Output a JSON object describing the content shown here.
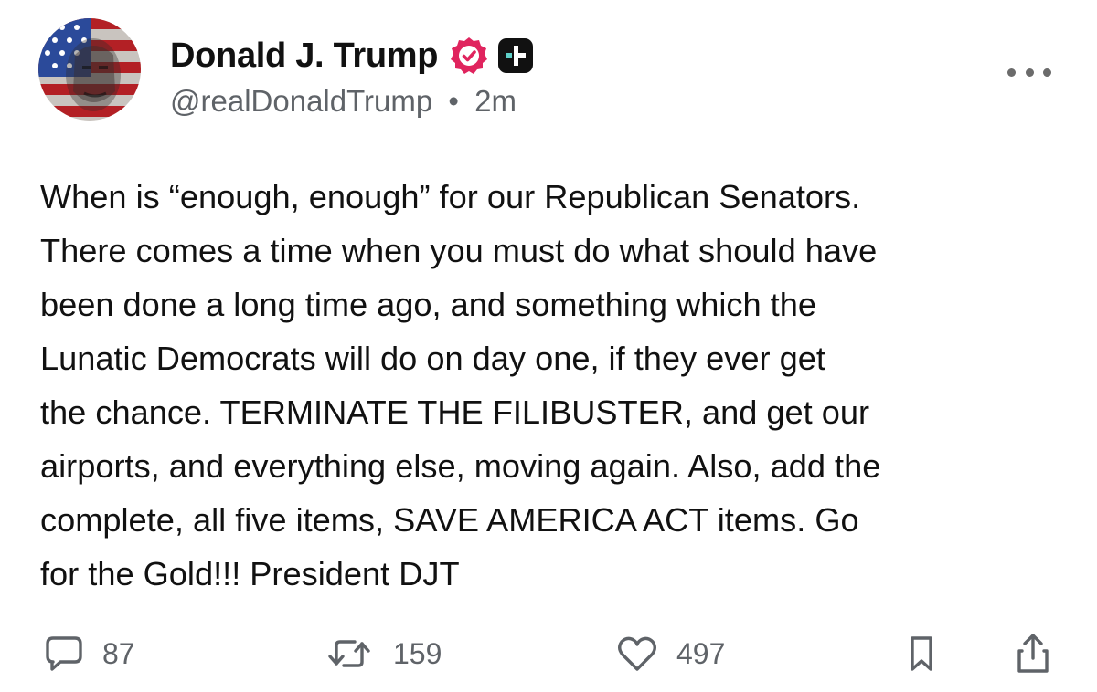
{
  "post": {
    "author": {
      "display_name": "Donald J. Trump",
      "handle": "@realDonaldTrump",
      "time": "2m",
      "separator": "•",
      "verified_badge": "verified-badge-icon",
      "badge_color": "#e0245e",
      "plus_badge": "plus-badge-icon",
      "avatar": "avatar-image"
    },
    "text": "When is “enough, enough” for our Republican Senators.\nThere comes a time when you must do what should have\nbeen done a long time ago, and something which the\nLunatic Democrats will do on day one, if they ever get\nthe chance. TERMINATE THE FILIBUSTER, and get our\nairports, and everything else, moving again. Also, add the\ncomplete, all five items, SAVE AMERICA ACT items. Go\nfor the Gold!!! President DJT",
    "actions": {
      "replies": "87",
      "reposts": "159",
      "likes": "497",
      "reply_icon": "comment-icon",
      "repost_icon": "repost-icon",
      "like_icon": "heart-icon",
      "bookmark_icon": "bookmark-icon",
      "share_icon": "share-icon"
    },
    "more_icon": "more-options-icon"
  },
  "colors": {
    "text": "#111111",
    "secondary": "#5f6368",
    "verified": "#e0245e",
    "plus_badge_bg": "#111111",
    "plus_badge_accent": "#5fd0c8"
  }
}
